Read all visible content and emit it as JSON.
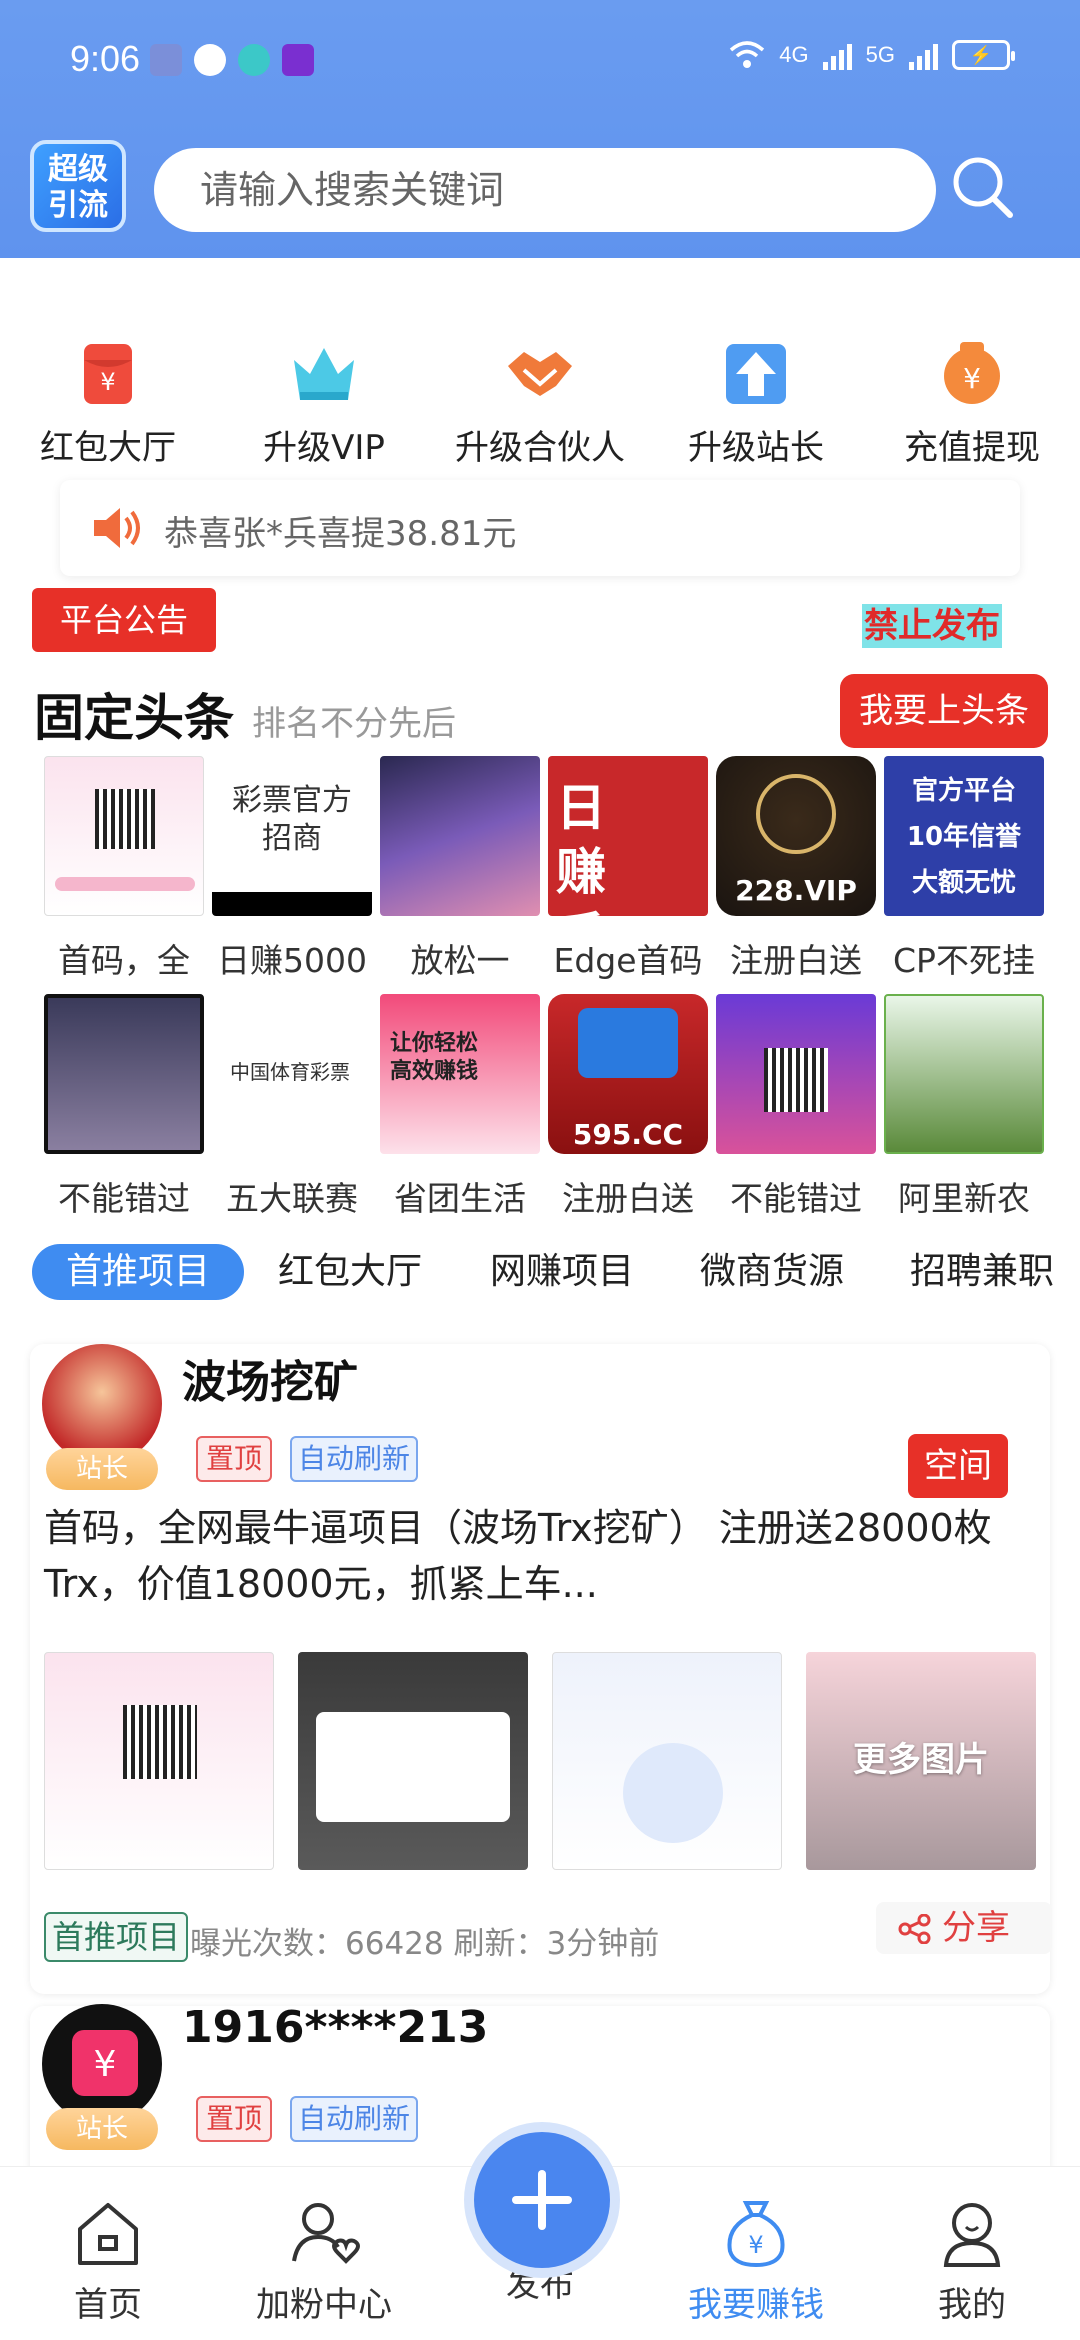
{
  "status_bar": {
    "time": "9:06",
    "net1": "4G",
    "net2": "5G"
  },
  "header": {
    "logo_text_1": "超级",
    "logo_text_2": "引流",
    "search_placeholder": "请输入搜索关键词"
  },
  "quick_menu": [
    {
      "label": "红包大厅",
      "icon": "red-envelope-icon"
    },
    {
      "label": "升级VIP",
      "icon": "crown-icon"
    },
    {
      "label": "升级合伙人",
      "icon": "handshake-icon"
    },
    {
      "label": "升级站长",
      "icon": "upgrade-arrow-icon"
    },
    {
      "label": "充值提现",
      "icon": "money-bag-icon"
    }
  ],
  "notice": {
    "text": "恭喜张*兵喜提38.81元"
  },
  "announcement": {
    "label": "平台公告",
    "ban_label": "禁止发布"
  },
  "fixed_headlines": {
    "title": "固定头条",
    "subtitle": "排名不分先后",
    "apply_label": "我要上头条",
    "row1": [
      {
        "caption": "首码，全",
        "thumb_text": ""
      },
      {
        "caption": "日赚5000",
        "thumb_text": "彩票官方招商"
      },
      {
        "caption": "放松一",
        "thumb_text": ""
      },
      {
        "caption": "Edge首码",
        "thumb_text": "日赚千元"
      },
      {
        "caption": "注册白送",
        "thumb_text": "228.VIP"
      },
      {
        "caption": "CP不死挂",
        "thumb_text": "官方平台 10年信誉 大额无忧"
      }
    ],
    "row2": [
      {
        "caption": "不能错过",
        "thumb_text": ""
      },
      {
        "caption": "五大联赛",
        "thumb_text": "中国体育彩票"
      },
      {
        "caption": "省团生活",
        "thumb_text": "让你轻松 高效赚钱"
      },
      {
        "caption": "注册白送",
        "thumb_text": "595.CC"
      },
      {
        "caption": "不能错过",
        "thumb_text": ""
      },
      {
        "caption": "阿里新农",
        "thumb_text": ""
      }
    ]
  },
  "categories": [
    "首推项目",
    "红包大厅",
    "网赚项目",
    "微商货源",
    "招聘兼职"
  ],
  "post1": {
    "title": "波场挖矿",
    "owner_badge": "站长",
    "tag_top": "置顶",
    "tag_refresh": "自动刷新",
    "space_label": "空间",
    "description": "首码，全网最牛逼项目（波场Trx挖矿）  注册送28000枚Trx，价值18000元，抓紧上车...",
    "more_images": "更多图片",
    "tag_recommend": "首推项目",
    "stats": "曝光次数：66428   刷新：3分钟前",
    "share_label": "分享"
  },
  "post2": {
    "title": "1916****213",
    "owner_badge": "站长",
    "tag_top": "置顶",
    "tag_refresh": "自动刷新"
  },
  "bottom_nav": [
    {
      "label": "首页",
      "icon": "home-icon"
    },
    {
      "label": "加粉中心",
      "icon": "add-friend-icon"
    },
    {
      "label": "发布",
      "icon": "plus-icon"
    },
    {
      "label": "我要赚钱",
      "icon": "money-bag-icon"
    },
    {
      "label": "我的",
      "icon": "user-icon"
    }
  ],
  "colors": {
    "header_blue": "#6a9cf0",
    "accent_red": "#e73028",
    "active_blue": "#3f8cf1"
  }
}
